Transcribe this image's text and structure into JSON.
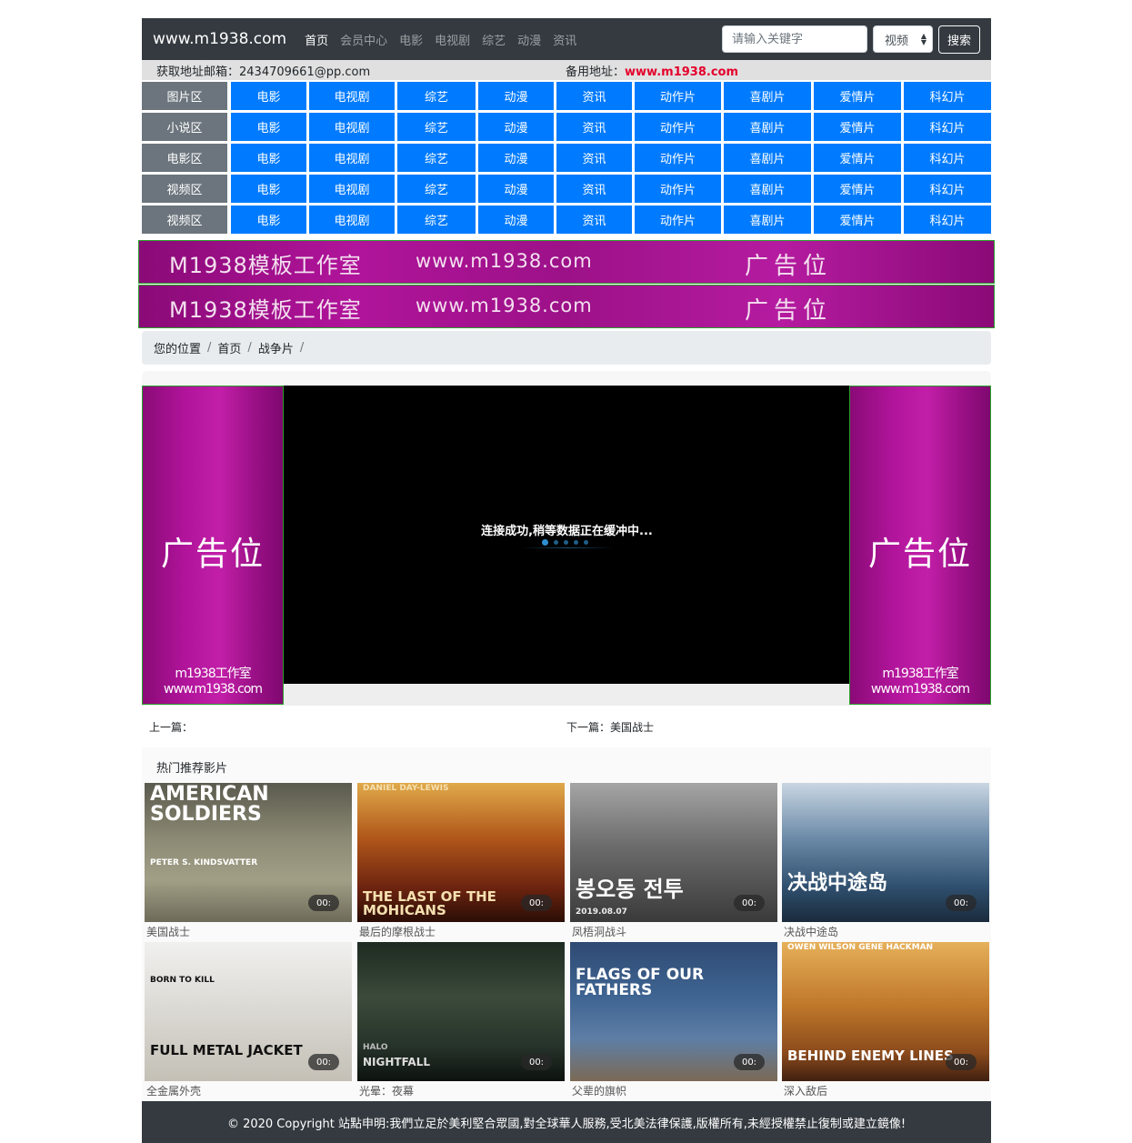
{
  "navbar": {
    "brand": "www.m1938.com",
    "links": [
      "首页",
      "会员中心",
      "电影",
      "电视剧",
      "综艺",
      "动漫",
      "资讯"
    ],
    "search_placeholder": "请输入关键字",
    "select_value": "视频",
    "search_button": "搜索"
  },
  "contact": {
    "email_label": "获取地址邮箱：",
    "email": "2434709661@pp.com",
    "backup_label": "备用地址：",
    "backup_url": "www.m1938.com"
  },
  "category_grid": {
    "rows": [
      {
        "label": "图片区",
        "cells": [
          "电影",
          "电视剧",
          "综艺",
          "动漫",
          "资讯",
          "动作片",
          "喜剧片",
          "爱情片",
          "科幻片"
        ]
      },
      {
        "label": "小说区",
        "cells": [
          "电影",
          "电视剧",
          "综艺",
          "动漫",
          "资讯",
          "动作片",
          "喜剧片",
          "爱情片",
          "科幻片"
        ]
      },
      {
        "label": "电影区",
        "cells": [
          "电影",
          "电视剧",
          "综艺",
          "动漫",
          "资讯",
          "动作片",
          "喜剧片",
          "爱情片",
          "科幻片"
        ]
      },
      {
        "label": "视频区",
        "cells": [
          "电影",
          "电视剧",
          "综艺",
          "动漫",
          "资讯",
          "动作片",
          "喜剧片",
          "爱情片",
          "科幻片"
        ]
      },
      {
        "label": "视频区",
        "cells": [
          "电影",
          "电视剧",
          "综艺",
          "动漫",
          "资讯",
          "动作片",
          "喜剧片",
          "爱情片",
          "科幻片"
        ]
      }
    ]
  },
  "banners": [
    {
      "studio": "M1938模板工作室",
      "url": "www.m1938.com",
      "ad": "广告位"
    },
    {
      "studio": "M1938模板工作室",
      "url": "www.m1938.com",
      "ad": "广告位"
    }
  ],
  "breadcrumb": {
    "items": [
      "您的位置",
      "首页",
      "战争片"
    ],
    "separator": "/"
  },
  "player": {
    "status": "连接成功,稍等数据正在缓冲中...",
    "side_ad_text": "广告位",
    "side_ad_watermark": "m1938工作室www.m1938.com"
  },
  "prev_next": {
    "prev_label": "上一篇：",
    "prev_title": "",
    "next_label": "下一篇：",
    "next_title": "美国战士"
  },
  "recommend": {
    "title": "热门推荐影片",
    "movies": [
      {
        "name": "美国战士",
        "duration": "00:",
        "poster_text": "AMERICAN SOLDIERS",
        "poster_sub": "PETER S. KINDSVATTER"
      },
      {
        "name": "最后的摩根战士",
        "duration": "00:",
        "poster_text": "THE LAST OF THE MOHICANS",
        "poster_sub": "DANIEL DAY-LEWIS"
      },
      {
        "name": "凤梧洞战斗",
        "duration": "00:",
        "poster_text": "봉오동 전투",
        "poster_sub": "2019.08.07"
      },
      {
        "name": "决战中途岛",
        "duration": "00:",
        "poster_text": "决战中途岛",
        "poster_sub": ""
      },
      {
        "name": "全金属外壳",
        "duration": "00:",
        "poster_text": "FULL METAL JACKET",
        "poster_sub": "BORN TO KILL"
      },
      {
        "name": "光晕：夜幕",
        "duration": "00:",
        "poster_text": "NIGHTFALL",
        "poster_sub": "HALO"
      },
      {
        "name": "父辈的旗帜",
        "duration": "00:",
        "poster_text": "FLAGS OF OUR FATHERS",
        "poster_sub": ""
      },
      {
        "name": "深入敌后",
        "duration": "00:",
        "poster_text": "BEHIND ENEMY LINES",
        "poster_sub": "OWEN WILSON   GENE HACKMAN"
      }
    ]
  },
  "footer": {
    "text": "© 2020 Copyright 站點申明:我們立足於美利堅合眾國,對全球華人服務,受北美法律保護,版權所有,未經授權禁止復制或建立鏡像!"
  },
  "colors": {
    "navbar": "#343a40",
    "grid_label": "#6c757d",
    "grid_cell": "#007bff",
    "ad_magenta": "#a8128f",
    "accent_red": "#e4002b"
  }
}
